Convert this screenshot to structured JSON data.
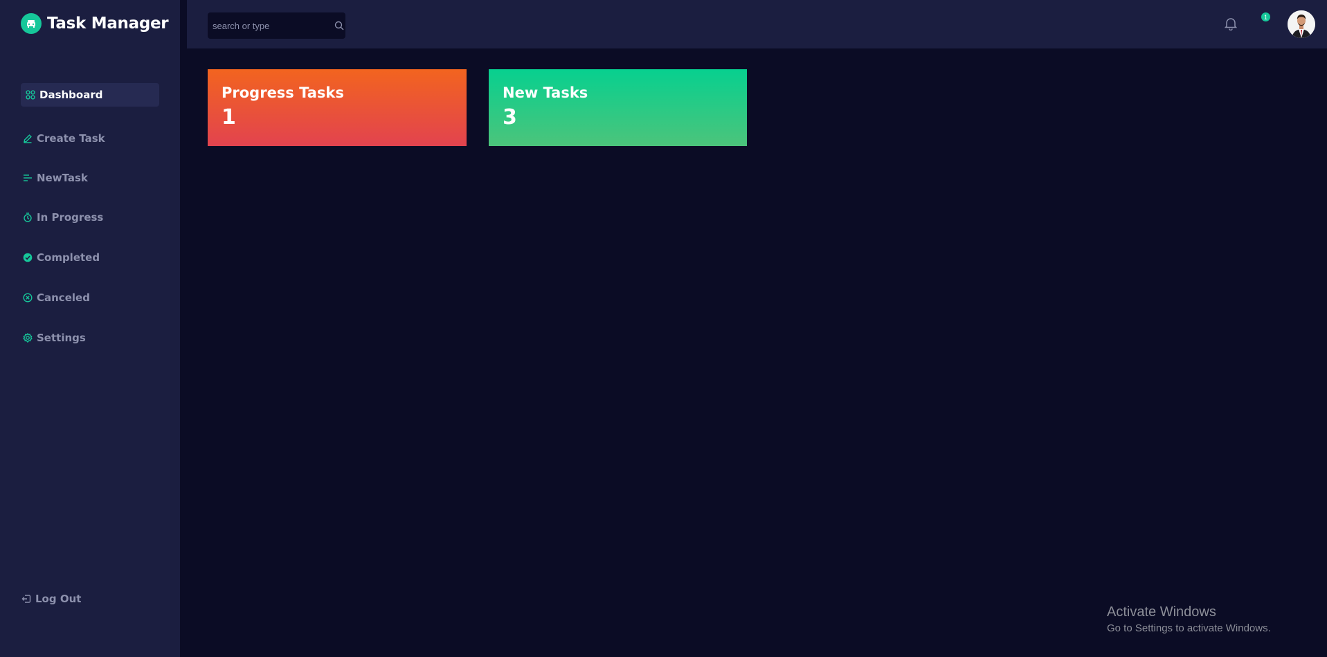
{
  "app": {
    "title": "Task Manager"
  },
  "sidebar": {
    "items": [
      {
        "label": "Dashboard",
        "icon": "grid-icon",
        "active": true
      },
      {
        "label": "Create Task",
        "icon": "pencil-icon"
      },
      {
        "label": "NewTask",
        "icon": "list-icon"
      },
      {
        "label": "In Progress",
        "icon": "stopwatch-icon"
      },
      {
        "label": "Completed",
        "icon": "check-circle-icon"
      },
      {
        "label": "Canceled",
        "icon": "x-circle-icon"
      },
      {
        "label": "Settings",
        "icon": "gear-icon"
      }
    ],
    "logout": {
      "label": "Log Out",
      "icon": "logout-icon"
    }
  },
  "header": {
    "search": {
      "placeholder": "search or type",
      "value": ""
    },
    "notifications": {
      "count": "1"
    }
  },
  "cards": [
    {
      "title": "Progress Tasks",
      "value": "1"
    },
    {
      "title": "New Tasks",
      "value": "3"
    }
  ],
  "watermark": {
    "title": "Activate Windows",
    "subtitle": "Go to Settings to activate Windows."
  },
  "colors": {
    "accent": "#16c79a",
    "sidebar_bg": "#1b1e40",
    "page_bg": "#0b0c25",
    "progress_gradient": [
      "#f2641f",
      "#e2434f"
    ],
    "new_gradient": [
      "#07d08f",
      "#4cc47b"
    ]
  }
}
